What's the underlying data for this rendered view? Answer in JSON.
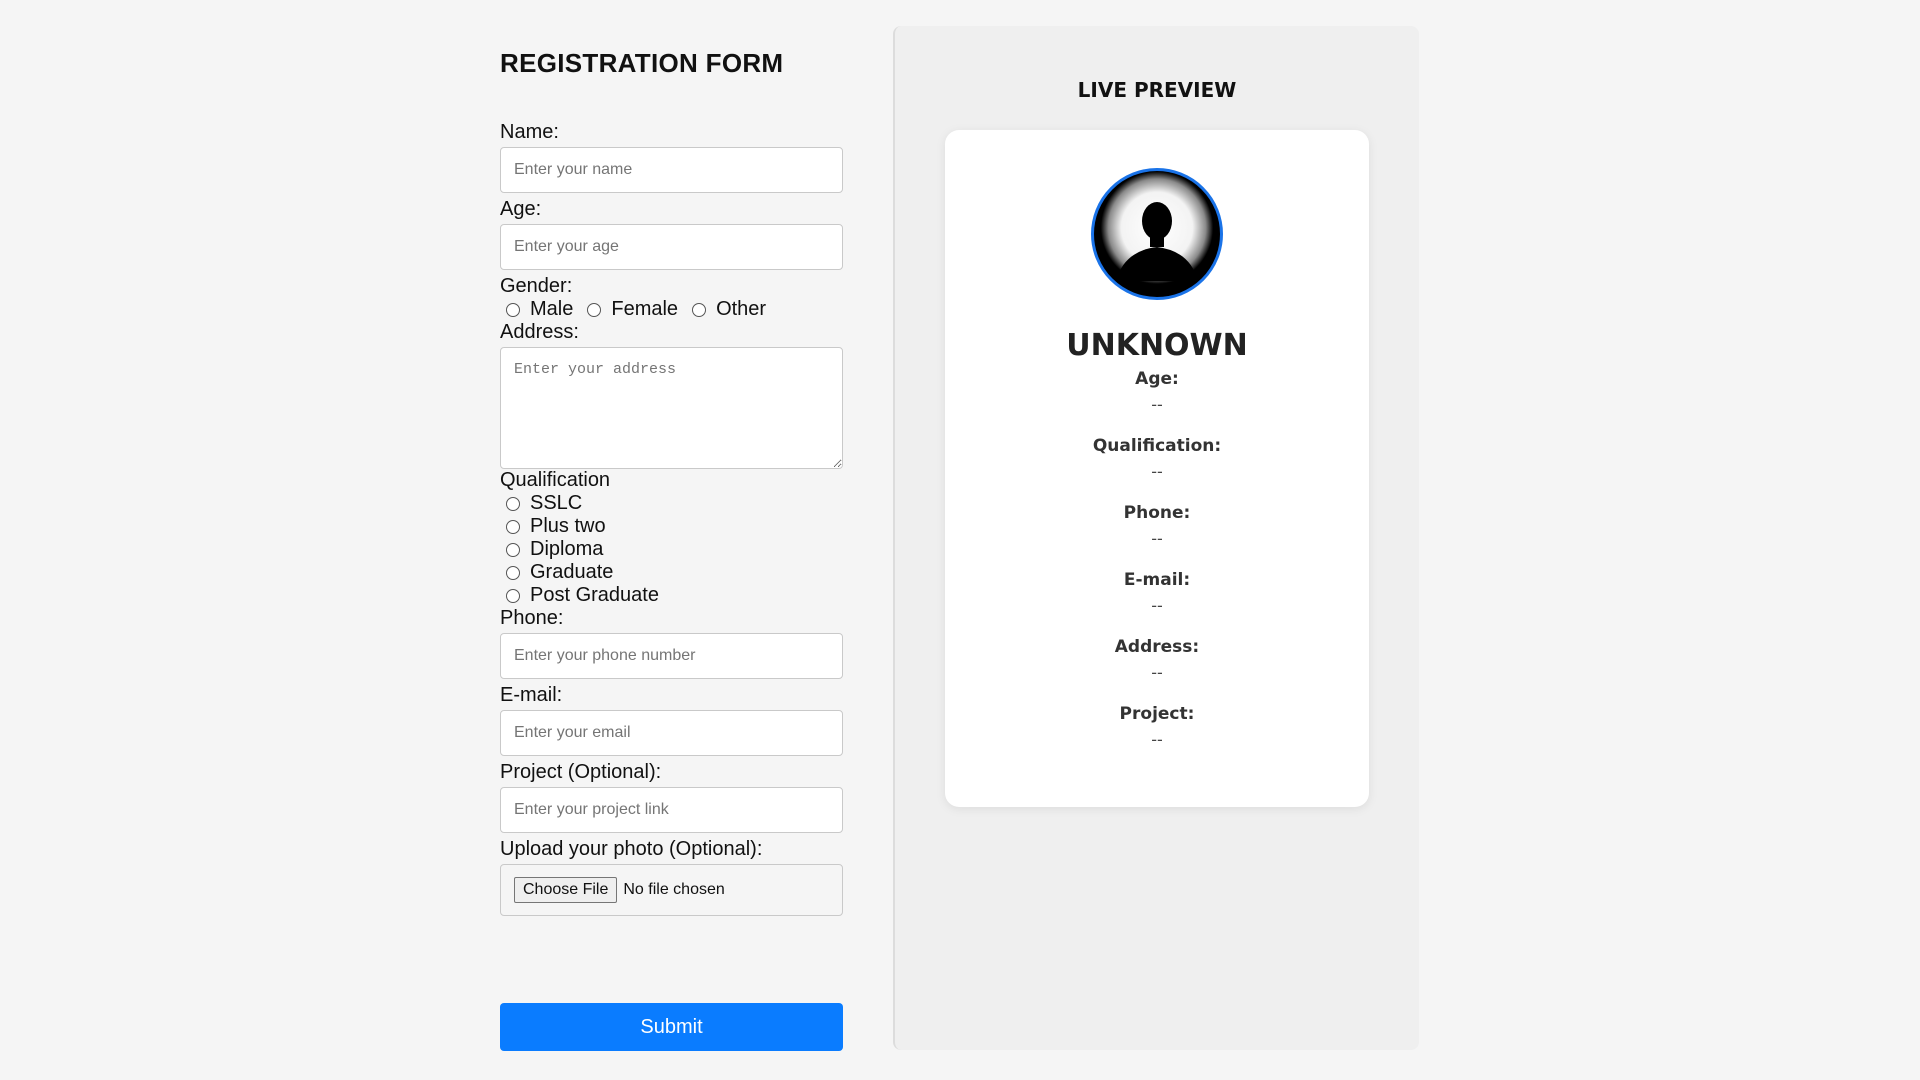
{
  "form": {
    "title": "REGISTRATION FORM",
    "name": {
      "label": "Name:",
      "placeholder": "Enter your name"
    },
    "age": {
      "label": "Age:",
      "placeholder": "Enter your age"
    },
    "gender": {
      "label": "Gender:",
      "options": [
        "Male",
        "Female",
        "Other"
      ]
    },
    "address": {
      "label": "Address:",
      "placeholder": "Enter your address"
    },
    "qualification": {
      "label": "Qualification",
      "options": [
        "SSLC",
        "Plus two",
        "Diploma",
        "Graduate",
        "Post Graduate"
      ]
    },
    "phone": {
      "label": "Phone:",
      "placeholder": "Enter your phone number"
    },
    "email": {
      "label": "E-mail:",
      "placeholder": "Enter your email"
    },
    "project": {
      "label": "Project (Optional):",
      "placeholder": "Enter your project link"
    },
    "photo": {
      "label": "Upload your photo (Optional):",
      "button": "Choose File",
      "status": "No file chosen"
    },
    "submit": "Submit"
  },
  "preview": {
    "title": "LIVE PREVIEW",
    "name": "UNKNOWN",
    "avatar_icon": "user-silhouette-icon",
    "fields": [
      {
        "label": "Age:",
        "value": "--"
      },
      {
        "label": "Qualification:",
        "value": "--"
      },
      {
        "label": "Phone:",
        "value": "--"
      },
      {
        "label": "E-mail:",
        "value": "--"
      },
      {
        "label": "Address:",
        "value": "--"
      },
      {
        "label": "Project:",
        "value": "--"
      }
    ]
  },
  "colors": {
    "accent": "#0a7cff",
    "avatar_border": "#1a73e8",
    "background": "#f5f5f5"
  }
}
